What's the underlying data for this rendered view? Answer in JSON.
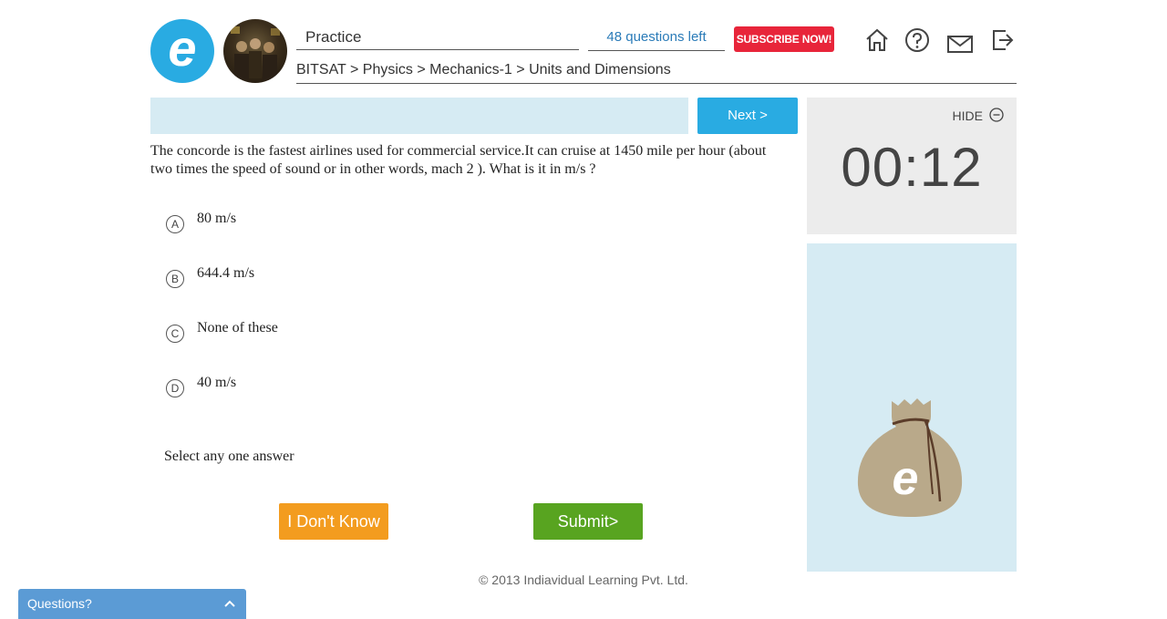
{
  "header": {
    "logo_letter": "e",
    "mode_title": "Practice",
    "questions_left": "48 questions left",
    "subscribe_label": "SUBSCRIBE NOW!",
    "icons": [
      "home-icon",
      "help-icon",
      "mail-icon",
      "logout-icon"
    ],
    "breadcrumb": "BITSAT > Physics > Mechanics-1 > Units and Dimensions"
  },
  "question": {
    "next_label": "Next >",
    "text": "The concorde is the fastest airlines used for commercial service.It can cruise at 1450 mile per hour (about  two times the speed of sound or in other words, mach 2 ). What is it in m/s ?",
    "options": [
      {
        "letter": "A",
        "text": "80 m/s"
      },
      {
        "letter": "B",
        "text": "644.4 m/s"
      },
      {
        "letter": "C",
        "text": "None of these"
      },
      {
        "letter": "D",
        "text": "40 m/s"
      }
    ],
    "hint": "Select any one answer",
    "dont_know_label": "I Don't Know",
    "submit_label": "Submit>"
  },
  "timer": {
    "hide_label": "HIDE",
    "value": "00:12"
  },
  "bag": {
    "logo_letter": "e"
  },
  "footer": {
    "copyright": "© 2013 Indiavidual Learning Pvt. Ltd."
  },
  "questions_widget": {
    "label": "Questions?"
  },
  "colors": {
    "brand_blue": "#29abe2",
    "subscribe_red": "#e8253a",
    "dont_know_orange": "#f39c1f",
    "submit_green": "#58a420",
    "panel_light_blue": "#d6ebf3"
  }
}
